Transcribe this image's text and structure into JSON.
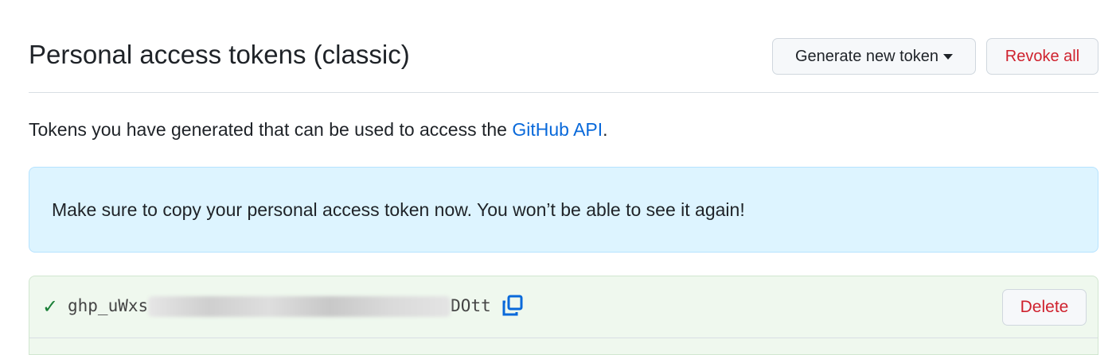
{
  "header": {
    "title": "Personal access tokens (classic)",
    "generate_label": "Generate new token",
    "revoke_label": "Revoke all"
  },
  "description": {
    "text": "Tokens you have generated that can be used to access the ",
    "link": "GitHub API",
    "suffix": "."
  },
  "flash": {
    "message": "Make sure to copy your personal access token now. You won’t be able to see it again!"
  },
  "token": {
    "prefix": "ghp_uWxs",
    "suffix": "DOtt",
    "delete_label": "Delete"
  }
}
